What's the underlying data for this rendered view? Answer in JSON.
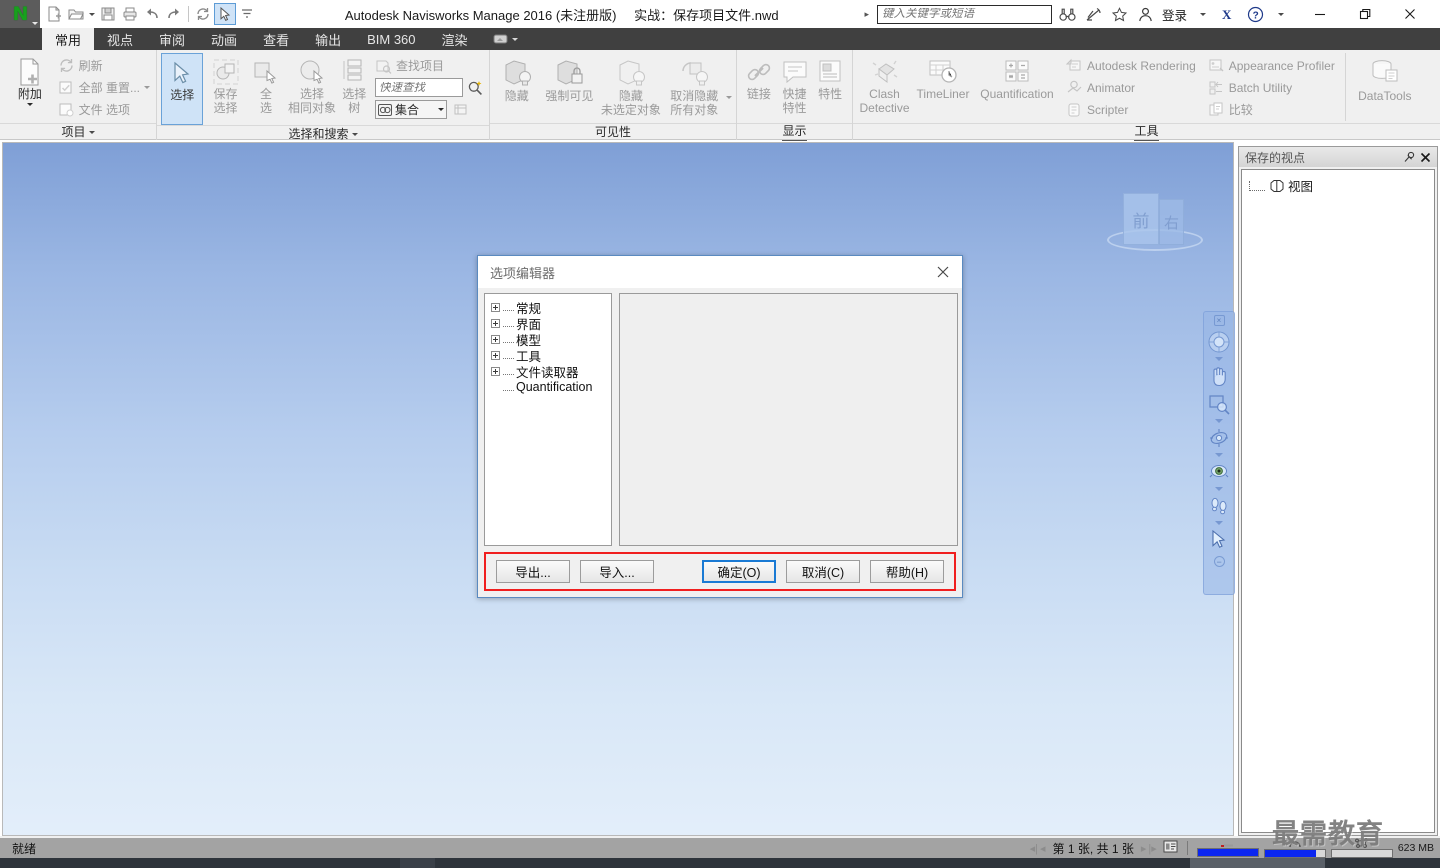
{
  "titlebar": {
    "logo_glyph": "N",
    "app_title": "Autodesk Navisworks Manage 2016 (未注册版)",
    "document_title": "实战：保存项目文件.nwd",
    "search_placeholder": "键入关键字或短语",
    "search_value": "",
    "signin_label": "登录",
    "quick_access": [
      {
        "name": "new-file-icon",
        "label": "新建"
      },
      {
        "name": "open-file-icon",
        "label": "打开"
      },
      {
        "name": "save-icon",
        "label": "保存"
      },
      {
        "name": "print-icon",
        "label": "打印"
      },
      {
        "name": "undo-icon",
        "label": "撤消"
      },
      {
        "name": "redo-icon",
        "label": "重做"
      },
      {
        "name": "refresh-icon",
        "label": "刷新"
      },
      {
        "name": "select-icon",
        "label": "选择"
      }
    ],
    "window_controls": [
      "minimize",
      "restore",
      "close"
    ]
  },
  "tabs": [
    {
      "label": "常用",
      "active": true
    },
    {
      "label": "视点",
      "active": false
    },
    {
      "label": "审阅",
      "active": false
    },
    {
      "label": "动画",
      "active": false
    },
    {
      "label": "查看",
      "active": false
    },
    {
      "label": "输出",
      "active": false
    },
    {
      "label": "BIM 360",
      "active": false
    },
    {
      "label": "渲染",
      "active": false
    }
  ],
  "ribbon": {
    "groups": [
      {
        "title": "项目",
        "has_dropdown": true,
        "big": {
          "label": "附加",
          "has_caret": true
        },
        "small": [
          {
            "label": "刷新"
          },
          {
            "label": "全部 重置...",
            "has_caret": true
          },
          {
            "label": "文件 选项"
          }
        ]
      },
      {
        "title": "选择和搜索",
        "has_dropdown": true,
        "buttons": [
          {
            "label_top": "选择",
            "label_bot": "",
            "selected": true,
            "has_caret": true
          },
          {
            "label_top": "保存",
            "label_bot": "选择"
          },
          {
            "label_top": "全",
            "label_bot": "选",
            "has_caret": true
          },
          {
            "label_top": "选择",
            "label_bot": "相同对象",
            "has_caret": true
          },
          {
            "label_top": "选择",
            "label_bot": "树"
          }
        ],
        "find_item_label": "查找项目",
        "quick_find_placeholder": "快速查找",
        "quick_find_value": "",
        "set_label": "集合"
      },
      {
        "title": "可见性",
        "buttons": [
          {
            "label_top": "隐藏",
            "label_bot": ""
          },
          {
            "label_top": "强制可见",
            "label_bot": ""
          },
          {
            "label_top": "隐藏",
            "label_bot": "未选定对象"
          },
          {
            "label_top": "取消隐藏",
            "label_bot": "所有对象",
            "has_caret": true
          }
        ]
      },
      {
        "title": "显示",
        "buttons": [
          {
            "label_top": "链接",
            "label_bot": ""
          },
          {
            "label_top": "快捷",
            "label_bot": "特性"
          },
          {
            "label_top": "特性",
            "label_bot": ""
          }
        ]
      },
      {
        "title": "工具",
        "buttons": [
          {
            "label_top": "Clash",
            "label_bot": "Detective"
          },
          {
            "label_top": "TimeLiner",
            "label_bot": ""
          },
          {
            "label_top": "Quantification",
            "label_bot": ""
          }
        ],
        "list_col_1": [
          "Autodesk Rendering",
          "Animator",
          "Scripter"
        ],
        "list_col_2": [
          "Appearance Profiler",
          "Batch Utility",
          "比较"
        ],
        "data_tools_label": "DataTools"
      }
    ]
  },
  "viewport": {
    "viewcube": {
      "front_face": "前",
      "right_face": "右"
    },
    "nav_tools": [
      "steering-wheel-icon",
      "pan-hand-icon",
      "zoom-window-icon",
      "orbit-icon",
      "look-around-icon",
      "walk-icon",
      "select-arrow-icon"
    ]
  },
  "dock": {
    "title": "保存的视点",
    "pin_icon": "pin-icon",
    "close_icon": "close-icon",
    "items": [
      {
        "label": "视图",
        "icon": "viewpoint-icon"
      }
    ]
  },
  "dialog": {
    "title": "选项编辑器",
    "close_label": "×",
    "tree": [
      {
        "label": "常规",
        "expandable": true
      },
      {
        "label": "界面",
        "expandable": true
      },
      {
        "label": "模型",
        "expandable": true
      },
      {
        "label": "工具",
        "expandable": true
      },
      {
        "label": "文件读取器",
        "expandable": true
      },
      {
        "label": "Quantification",
        "expandable": false
      }
    ],
    "buttons": {
      "export": "导出...",
      "import": "导入...",
      "ok": "确定(O)",
      "cancel": "取消(C)",
      "help": "帮助(H)"
    },
    "highlight_color": "#f01f1f",
    "primary_color": "#1a7ad4"
  },
  "statusbar": {
    "status_text": "就绪",
    "page_text": "第 1 张, 共 1 张",
    "memory_text": "623 MB",
    "meters": [
      {
        "name": "drawing-meter",
        "percent": 100
      },
      {
        "name": "render-meter",
        "percent": 85
      },
      {
        "name": "memory-meter",
        "percent": 0
      }
    ]
  },
  "watermark": {
    "text": "最需教育"
  }
}
